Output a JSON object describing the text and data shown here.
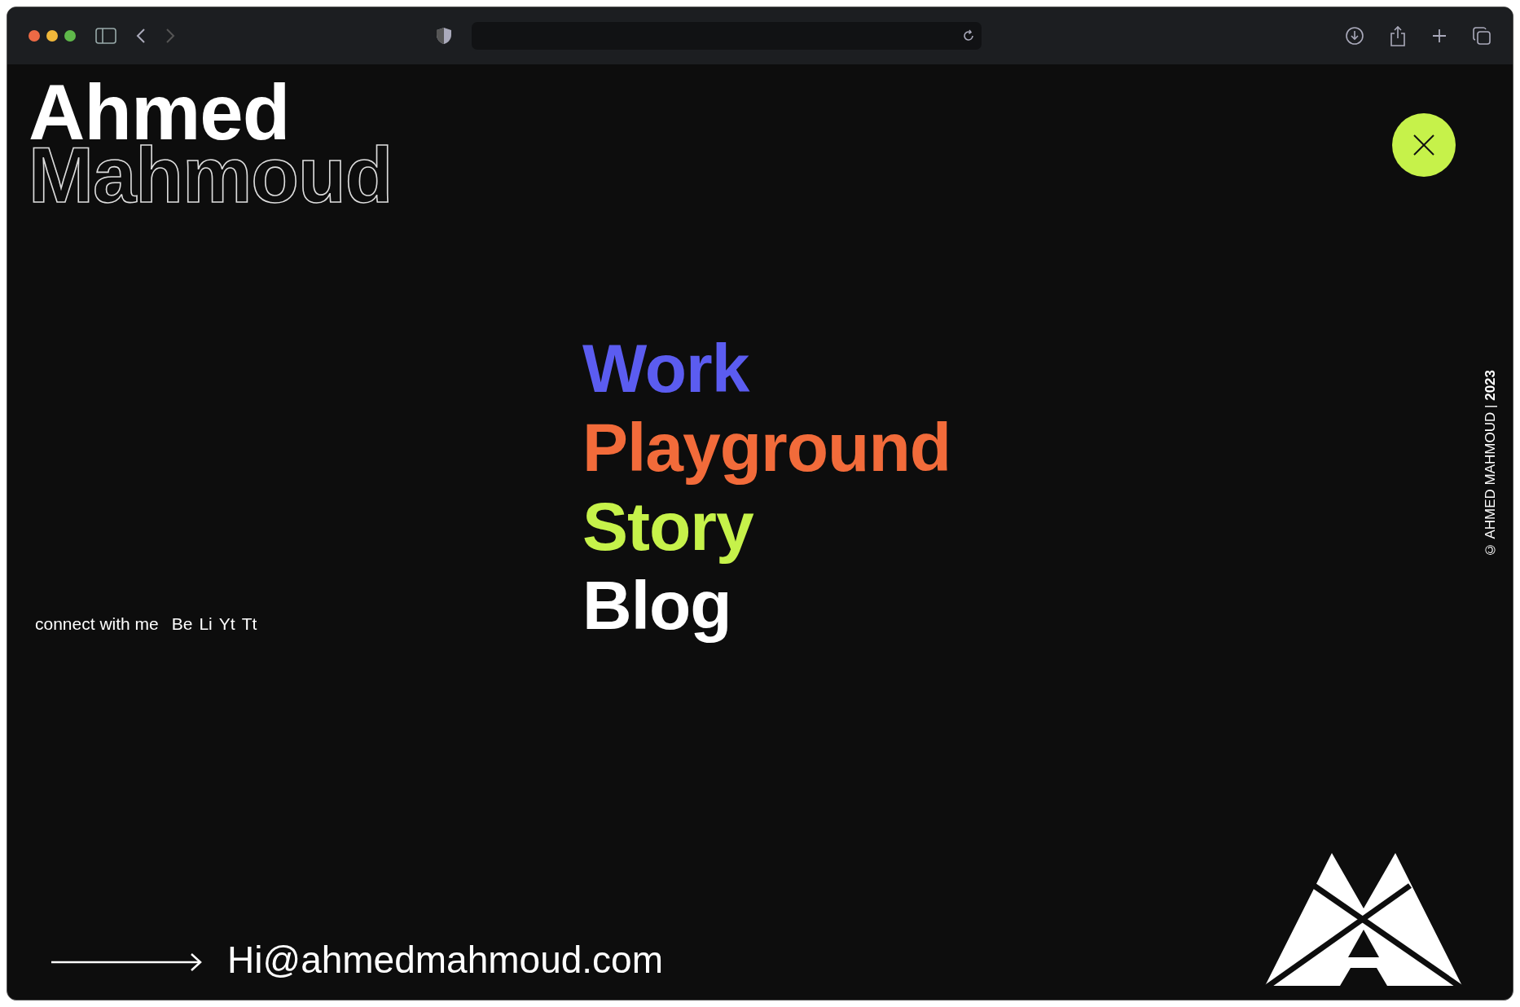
{
  "header": {
    "name_first": "Ahmed",
    "name_last": "Mahmoud"
  },
  "menu": [
    {
      "label": "Work",
      "color": "#5b5cf0"
    },
    {
      "label": "Playground",
      "color": "#f26b3a"
    },
    {
      "label": "Story",
      "color": "#c6f24a"
    },
    {
      "label": "Blog",
      "color": "#ffffff"
    }
  ],
  "connect": {
    "label": "connect with me",
    "links": [
      "Be",
      "Li",
      "Yt",
      "Tt"
    ]
  },
  "copyright": "© AHMED MAHMOUD | **2023**",
  "email": "Hi@ahmedmahmoud.com"
}
